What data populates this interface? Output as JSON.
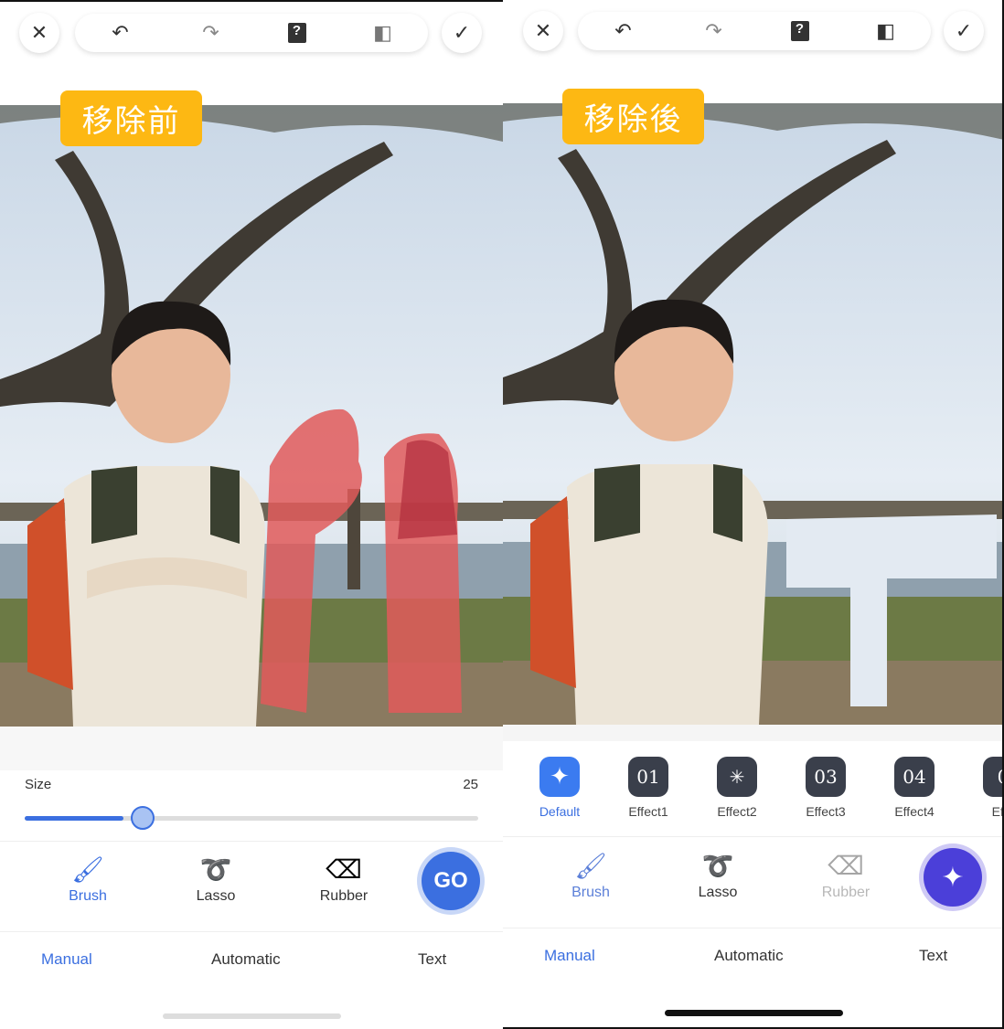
{
  "toolbar": {
    "close": "✕",
    "undo": "↶",
    "redo": "↷",
    "help": "?",
    "compare": "◧",
    "confirm": "✓"
  },
  "left": {
    "badge": "移除前",
    "size_label": "Size",
    "size_value": "25",
    "size_fraction": 0.25,
    "tools": [
      {
        "label": "Brush"
      },
      {
        "label": "Lasso"
      },
      {
        "label": "Rubber"
      }
    ],
    "go_label": "GO",
    "tabs": [
      {
        "label": "Manual"
      },
      {
        "label": "Automatic"
      },
      {
        "label": "Text"
      }
    ]
  },
  "right": {
    "badge": "移除後",
    "effects": [
      {
        "label": "Default",
        "glyph": "✦"
      },
      {
        "label": "Effect1",
        "glyph": "01"
      },
      {
        "label": "Effect2",
        "glyph": "✳"
      },
      {
        "label": "Effect3",
        "glyph": "03"
      },
      {
        "label": "Effect4",
        "glyph": "04"
      },
      {
        "label": "Effe",
        "glyph": "0"
      }
    ],
    "tools": [
      {
        "label": "Brush"
      },
      {
        "label": "Lasso"
      },
      {
        "label": "Rubber"
      }
    ],
    "tabs": [
      {
        "label": "Manual"
      },
      {
        "label": "Automatic"
      },
      {
        "label": "Text"
      }
    ]
  },
  "colors": {
    "accent": "#3B6FE0",
    "badge": "#FDB813",
    "mask": "#E05A5A",
    "ai": "#4B3FD9"
  }
}
